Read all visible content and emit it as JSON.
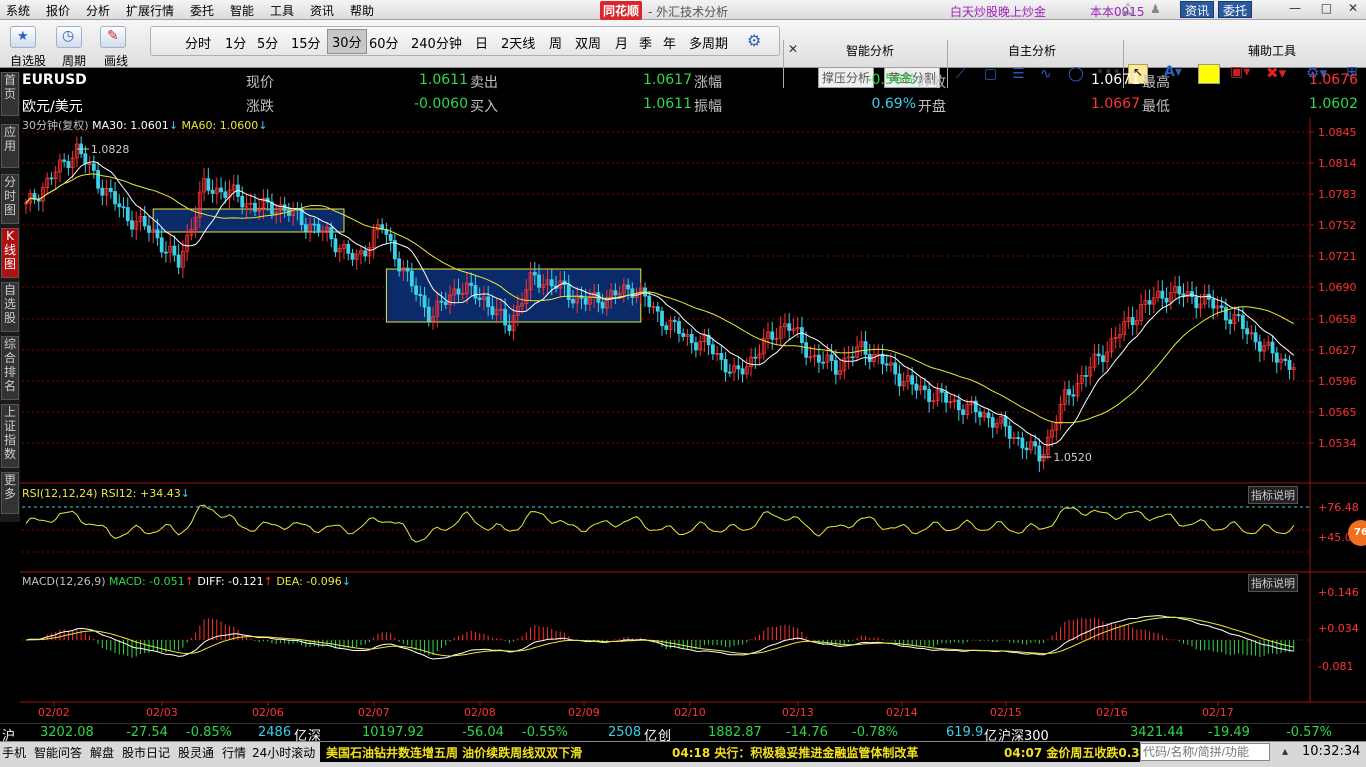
{
  "menu": [
    "系统",
    "报价",
    "分析",
    "扩展行情",
    "委托",
    "智能",
    "工具",
    "资讯",
    "帮助"
  ],
  "brand": "同花顺",
  "app_title": "- 外汇技术分析",
  "promo": "白天炒股晚上炒金",
  "user": "本本0915",
  "header_buttons": {
    "news": "资讯",
    "trade": "委托"
  },
  "toolbar": {
    "zixuan": "自选股",
    "zhouqi": "周期",
    "huaxian": "画线"
  },
  "periods": [
    "分时",
    "1分",
    "5分",
    "15分",
    "30分",
    "60分",
    "240分钟",
    "日",
    "2天线",
    "周",
    "双周",
    "月",
    "季",
    "年",
    "多周期"
  ],
  "active_period": "30分",
  "panels": {
    "smart": "智能分析",
    "self": "自主分析",
    "aux": "辅助工具",
    "btn1": "撑压分析",
    "btn2": "黄金分割"
  },
  "side_tabs": [
    "首页",
    "应用",
    "分时图",
    "K线图",
    "自选股",
    "综合排名",
    "上证指数",
    "更多"
  ],
  "quote": {
    "symbol": "EURUSD",
    "name": "欧元/美元",
    "l_now": "现价",
    "now": "1.0611",
    "l_sell": "卖出",
    "sell": "1.0617",
    "l_pct": "涨幅",
    "pct": "-0.56%",
    "l_prev": "昨收",
    "prev": "1.0671",
    "l_high": "最高",
    "high": "1.0676",
    "l_chg": "涨跌",
    "chg": "-0.0060",
    "l_buy": "买入",
    "buy": "1.0611",
    "l_amp": "振幅",
    "amp": "0.69%",
    "l_open": "开盘",
    "open": "1.0667",
    "l_low": "最低",
    "low": "1.0602"
  },
  "main_legend": {
    "period": "30分钟(复权)",
    "ma30": "MA30: 1.0601",
    "ma60": "MA60: 1.0600"
  },
  "rsi_legend": {
    "name": "RSI(12,12,24)",
    "rsi12": "RSI12: +34.43"
  },
  "macd_legend": {
    "name": "MACD(12,26,9)",
    "macd": "MACD: -0.051",
    "diff": "DIFF: -0.121",
    "dea": "DEA: -0.096"
  },
  "indicator_help": "指标说明",
  "badge": "76",
  "colors": {
    "up": "#ff3232",
    "down": "#3ad0e8",
    "ma": "#ffffff",
    "ma60": "#e8e83a",
    "grid": "#8b0000",
    "box": "#0a2a6a"
  },
  "chart_data": {
    "type": "candlestick",
    "y_ticks": [
      "1.0845",
      "1.0814",
      "1.0783",
      "1.0752",
      "1.0721",
      "1.0690",
      "1.0658",
      "1.0627",
      "1.0596",
      "1.0565",
      "1.0534"
    ],
    "ylim": [
      1.0503,
      1.0845
    ],
    "x_ticks": [
      "02/02",
      "02/03",
      "02/06",
      "02/07",
      "02/08",
      "02/09",
      "02/10",
      "02/13",
      "02/14",
      "02/15",
      "02/16",
      "02/17"
    ],
    "annotations": {
      "high": "1.0828",
      "low": "1.0520"
    },
    "price_path": [
      1.077,
      1.08,
      1.0828,
      1.079,
      1.076,
      1.0745,
      1.0712,
      1.079,
      1.0785,
      1.077,
      1.077,
      1.0755,
      1.074,
      1.0716,
      1.0752,
      1.07,
      1.066,
      1.069,
      1.068,
      1.065,
      1.07,
      1.069,
      1.0675,
      1.068,
      1.069,
      1.066,
      1.064,
      1.063,
      1.06,
      1.063,
      1.0655,
      1.062,
      1.061,
      1.063,
      1.061,
      1.059,
      1.058,
      1.057,
      1.056,
      1.054,
      1.052,
      1.058,
      1.061,
      1.064,
      1.067,
      1.0685,
      1.068,
      1.067,
      1.065,
      1.0625,
      1.0611
    ],
    "rsi_ticks": [
      "+76.48",
      "+45.07"
    ],
    "macd_ticks": [
      "+0.146",
      "+0.034",
      "-0.081"
    ]
  },
  "status": {
    "sh_label": "沪",
    "sh_val": "3202.08",
    "sh_chg": "-27.54",
    "sh_pct": "-0.85%",
    "sh_vol": "2486",
    "yi1": "亿",
    "sz_label": "深",
    "sz_val": "10197.92",
    "sz_chg": "-56.04",
    "sz_pct": "-0.55%",
    "sz_vol": "2508",
    "yi2": "亿",
    "cy_label": "创",
    "cy_val": "1882.87",
    "cy_chg": "-14.76",
    "cy_pct": "-0.78%",
    "cy_vol": "619.9",
    "yi3": "亿",
    "hs_label": "沪深300",
    "hs_val": "3421.44",
    "hs_chg": "-19.49",
    "hs_pct": "-0.57%"
  },
  "ticker": {
    "items": [
      "手机",
      "智能问答",
      "解盘",
      "股市日记",
      "股灵通",
      "行情",
      "24小时滚动"
    ],
    "news": [
      "美国石油钻井数连增五周 油价续跌周线双双下滑",
      "04:18 央行：积极稳妥推进金融监管体制改革",
      "04:07 金价周五收跌0.3"
    ],
    "search_placeholder": "代码/名称/简拼/功能",
    "clock": "10:32:34"
  }
}
